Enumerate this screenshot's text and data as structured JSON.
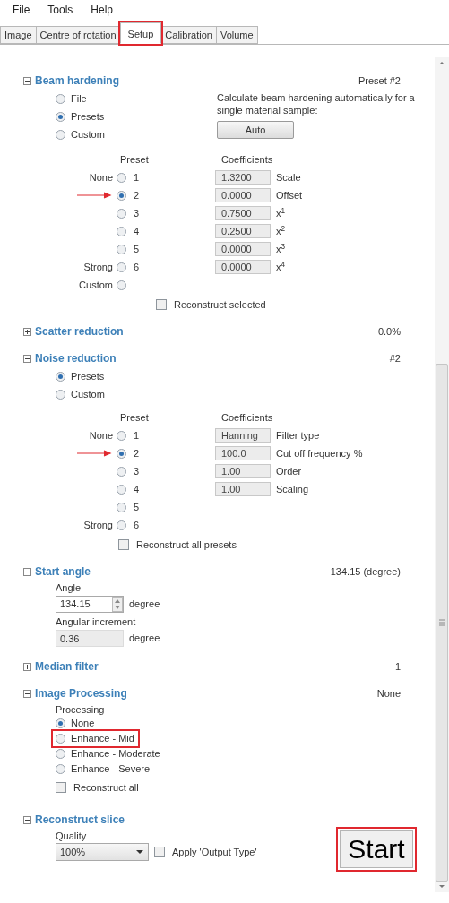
{
  "menu": [
    "File",
    "Tools",
    "Help"
  ],
  "tabs": [
    {
      "label": "Image",
      "selected": false,
      "highlighted": false
    },
    {
      "label": "Centre of rotation",
      "selected": false,
      "highlighted": false
    },
    {
      "label": "Setup",
      "selected": true,
      "highlighted": true
    },
    {
      "label": "Calibration",
      "selected": false,
      "highlighted": false
    },
    {
      "label": "Volume",
      "selected": false,
      "highlighted": false
    }
  ],
  "beam_hardening": {
    "title": "Beam hardening",
    "expanded": true,
    "summary": "Preset #2",
    "sources": [
      {
        "label": "File",
        "selected": false
      },
      {
        "label": "Presets",
        "selected": true
      },
      {
        "label": "Custom",
        "selected": false
      }
    ],
    "auto_text": "Calculate beam hardening automatically for a single material sample:",
    "auto_button": "Auto",
    "preset_header": "Preset",
    "coefficients_header": "Coefficients",
    "presets": [
      {
        "side": "None",
        "number": "1",
        "selected": false,
        "arrow": false
      },
      {
        "number": "2",
        "selected": true,
        "arrow": true
      },
      {
        "number": "3",
        "selected": false,
        "arrow": false
      },
      {
        "number": "4",
        "selected": false,
        "arrow": false
      },
      {
        "number": "5",
        "selected": false,
        "arrow": false
      },
      {
        "side": "Strong",
        "number": "6",
        "selected": false,
        "arrow": false
      },
      {
        "side": "Custom",
        "selected": false,
        "arrow": false
      }
    ],
    "coefficients": [
      {
        "value": "1.3200",
        "label": "Scale"
      },
      {
        "value": "0.0000",
        "label": "Offset"
      },
      {
        "value": "0.7500",
        "label": "x$^{1}$"
      },
      {
        "value": "0.2500",
        "label": "x$^{2}$"
      },
      {
        "value": "0.0000",
        "label": "x$^{3}$"
      },
      {
        "value": "0.0000",
        "label": "x$^{4}$"
      }
    ],
    "reconstruct": {
      "label": "Reconstruct selected",
      "checked": false
    }
  },
  "scatter_reduction": {
    "title": "Scatter reduction",
    "expanded": false,
    "summary": "0.0%"
  },
  "noise_reduction": {
    "title": "Noise reduction",
    "expanded": true,
    "summary": "#2",
    "sources": [
      {
        "label": "Presets",
        "selected": true
      },
      {
        "label": "Custom",
        "selected": false
      }
    ],
    "preset_header": "Preset",
    "coefficients_header": "Coefficients",
    "presets": [
      {
        "side": "None",
        "number": "1",
        "selected": false,
        "arrow": false
      },
      {
        "number": "2",
        "selected": true,
        "arrow": true
      },
      {
        "number": "3",
        "selected": false,
        "arrow": false
      },
      {
        "number": "4",
        "selected": false,
        "arrow": false
      },
      {
        "number": "5",
        "selected": false,
        "arrow": false
      },
      {
        "side": "Strong",
        "number": "6",
        "selected": false,
        "arrow": false
      }
    ],
    "coefficients": [
      {
        "value": "Hanning",
        "label": "Filter type"
      },
      {
        "value": "100.0",
        "label": "Cut off frequency %"
      },
      {
        "value": "1.00",
        "label": "Order"
      },
      {
        "value": "1.00",
        "label": "Scaling"
      }
    ],
    "reconstruct": {
      "label": "Reconstruct all presets",
      "checked": false
    }
  },
  "start_angle": {
    "title": "Start angle",
    "expanded": true,
    "summary": "134.15 (degree)",
    "angle_label": "Angle",
    "angle_value": "134.15",
    "angle_unit": "degree",
    "increment_label": "Angular increment",
    "increment_value": "0.36",
    "increment_unit": "degree"
  },
  "median_filter": {
    "title": "Median filter",
    "expanded": false,
    "summary": "1"
  },
  "image_processing": {
    "title": "Image Processing",
    "expanded": true,
    "summary": "None",
    "label": "Processing",
    "options": [
      {
        "label": "None",
        "selected": true,
        "highlighted": false
      },
      {
        "label": "Enhance - Mid",
        "selected": false,
        "highlighted": true
      },
      {
        "label": "Enhance - Moderate",
        "selected": false,
        "highlighted": false
      },
      {
        "label": "Enhance - Severe",
        "selected": false,
        "highlighted": false
      }
    ],
    "reconstruct": {
      "label": "Reconstruct all",
      "checked": false
    }
  },
  "reconstruct_slice": {
    "title": "Reconstruct slice",
    "expanded": true,
    "quality_label": "Quality",
    "quality": "100%",
    "apply": {
      "label": "Apply 'Output Type'",
      "checked": false
    },
    "start_button": "Start",
    "start_highlighted": true
  }
}
